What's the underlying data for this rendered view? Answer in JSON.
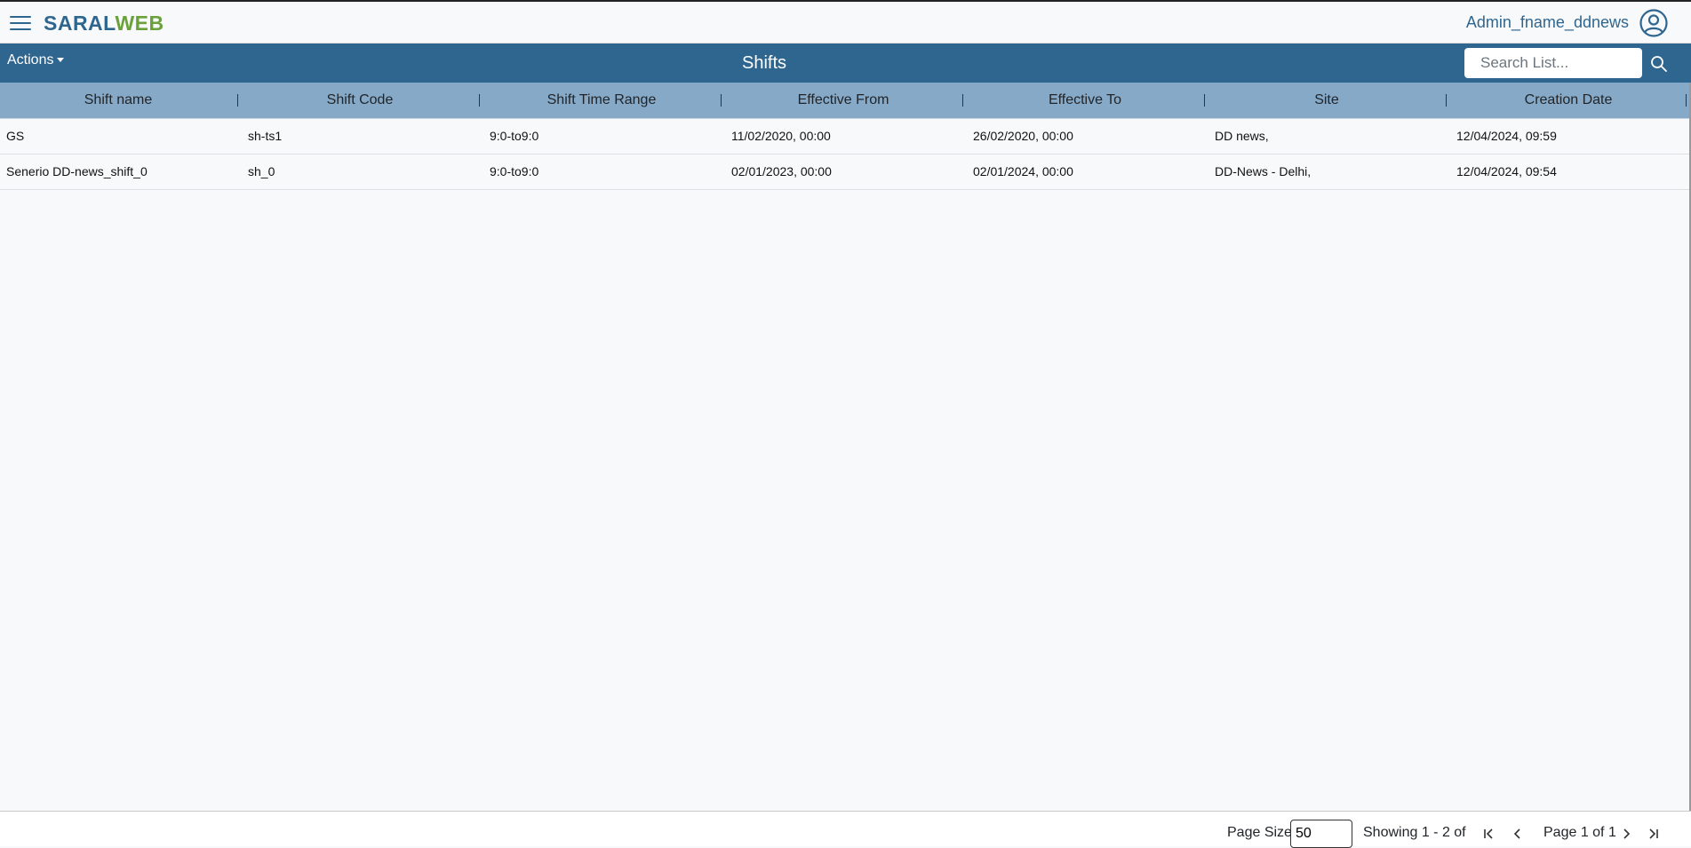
{
  "header": {
    "brand_part1": "SARAL",
    "brand_part2": "WEB",
    "username": "Admin_fname_ddnews",
    "menu_icon": "hamburger-menu-icon",
    "user_icon": "user-circle-icon"
  },
  "toolbar": {
    "actions_label": "Actions",
    "title": "Shifts",
    "search_placeholder": "Search List...",
    "search_icon": "search-icon"
  },
  "table": {
    "columns": [
      "Shift name",
      "Shift Code",
      "Shift Time Range",
      "Effective From",
      "Effective To",
      "Site",
      "Creation Date"
    ],
    "rows": [
      [
        "GS",
        "sh-ts1",
        "9:0-to9:0",
        "11/02/2020, 00:00",
        "26/02/2020, 00:00",
        "DD news,",
        "12/04/2024, 09:59"
      ],
      [
        "Senerio DD-news_shift_0",
        "sh_0",
        "9:0-to9:0",
        "02/01/2023, 00:00",
        "02/01/2024, 00:00",
        "DD-News - Delhi,",
        "12/04/2024, 09:54"
      ]
    ]
  },
  "footer": {
    "page_size_label": "Page Size",
    "page_size_value": "50",
    "showing_text": "Showing 1 - 2 of",
    "page_text": "Page 1 of 1"
  },
  "colors": {
    "primary": "#2f6690",
    "brand_green": "#6aa13a",
    "header_row": "#86a9c7"
  }
}
